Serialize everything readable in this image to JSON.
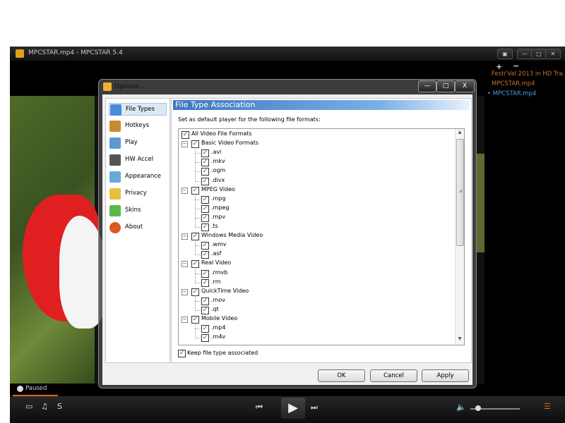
{
  "player": {
    "title": "MPCSTAR.mp4 - MPCSTAR 5.4",
    "window_buttons": [
      "▣",
      "—",
      "□",
      "✕"
    ],
    "playlist": {
      "add_label": "+",
      "remove_label": "−",
      "items": [
        "Festi'Val 2013 in HD Tra...",
        "MPCSTAR.mp4",
        "MPCSTAR.mp4"
      ],
      "active_marker": "•"
    },
    "status": "Paused",
    "controls": {
      "screen_icon": "▭",
      "audio_icon": "♫",
      "subtitle_label": "S",
      "prev_icon": "⏮",
      "play_icon": "▶",
      "next_icon": "⏭",
      "volume_icon": "🔈",
      "playlist_icon": "☰",
      "volume_level": 0.15
    }
  },
  "dialog": {
    "title": "Options...",
    "title_buttons": [
      "—",
      "□",
      "X"
    ],
    "nav": [
      {
        "label": "File Types",
        "icon": "file-types-icon"
      },
      {
        "label": "Hotkeys",
        "icon": "hotkeys-icon"
      },
      {
        "label": "Play",
        "icon": "play-monitor-icon"
      },
      {
        "label": "HW Accel",
        "icon": "hw-accel-icon"
      },
      {
        "label": "Appearance",
        "icon": "appearance-icon"
      },
      {
        "label": "Privacy",
        "icon": "privacy-lock-icon"
      },
      {
        "label": "Skins",
        "icon": "skins-icon"
      },
      {
        "label": "About",
        "icon": "about-icon"
      }
    ],
    "panel_title": "File Type Association",
    "panel_desc": "Set as default player for the following file formats:",
    "tree": {
      "root": "All Video File Formats",
      "groups": [
        {
          "label": "Basic Video Formats",
          "items": [
            ".avi",
            ".mkv",
            ".ogm",
            ".divx"
          ]
        },
        {
          "label": "MPEG Video",
          "items": [
            ".mpg",
            ".mpeg",
            ".mpv",
            ".ts"
          ]
        },
        {
          "label": "Windows Media Video",
          "items": [
            ".wmv",
            ".asf"
          ]
        },
        {
          "label": "Real Video",
          "items": [
            ".rmvb",
            ".rm"
          ]
        },
        {
          "label": "QuickTime Video",
          "items": [
            ".mov",
            ".qt"
          ]
        },
        {
          "label": "Mobile Video",
          "items": [
            ".mp4",
            ".m4v"
          ]
        }
      ],
      "check_mark": "✓",
      "collapse_mark": "−"
    },
    "scroll": {
      "up": "▲",
      "grip": "≡",
      "down": "▼"
    },
    "keep_label": "Keep file type associated",
    "buttons": {
      "ok": "OK",
      "cancel": "Cancel",
      "apply": "Apply"
    }
  },
  "colors": {
    "playlist_inactive": "#c8742a",
    "playlist_active": "#4a9be8",
    "progress": "#e06818",
    "accent_blue": "#3c78c0"
  }
}
